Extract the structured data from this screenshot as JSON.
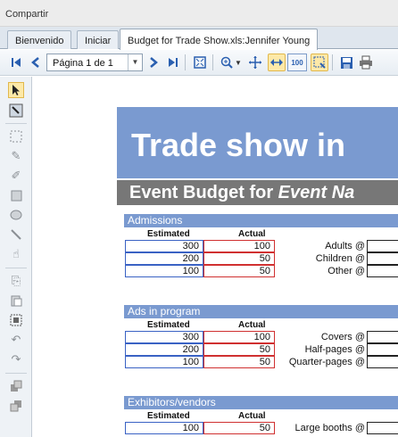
{
  "window": {
    "title": "Compartir"
  },
  "tabs": [
    {
      "label": "Bienvenido"
    },
    {
      "label": "Iniciar"
    },
    {
      "label": "Budget for Trade Show.xls:Jennifer Young"
    }
  ],
  "toolbar": {
    "page_indicator": "Página 1 de 1",
    "zoom_reset_label": "100"
  },
  "document": {
    "banner": "Trade show in",
    "subbanner_prefix": "Event Budget for ",
    "subbanner_italic": "Event Na",
    "sections": [
      {
        "title": "Admissions",
        "col_estimated": "Estimated",
        "col_actual": "Actual",
        "rows": [
          {
            "estimated": "300",
            "actual": "100",
            "label": "Adults @"
          },
          {
            "estimated": "200",
            "actual": "50",
            "label": "Children @"
          },
          {
            "estimated": "100",
            "actual": "50",
            "label": "Other @"
          }
        ]
      },
      {
        "title": "Ads in program",
        "col_estimated": "Estimated",
        "col_actual": "Actual",
        "rows": [
          {
            "estimated": "300",
            "actual": "100",
            "label": "Covers @"
          },
          {
            "estimated": "200",
            "actual": "50",
            "label": "Half-pages @"
          },
          {
            "estimated": "100",
            "actual": "50",
            "label": "Quarter-pages @"
          }
        ]
      },
      {
        "title": "Exhibitors/vendors",
        "col_estimated": "Estimated",
        "col_actual": "Actual",
        "rows": [
          {
            "estimated": "100",
            "actual": "50",
            "label": "Large booths @"
          }
        ]
      }
    ]
  }
}
